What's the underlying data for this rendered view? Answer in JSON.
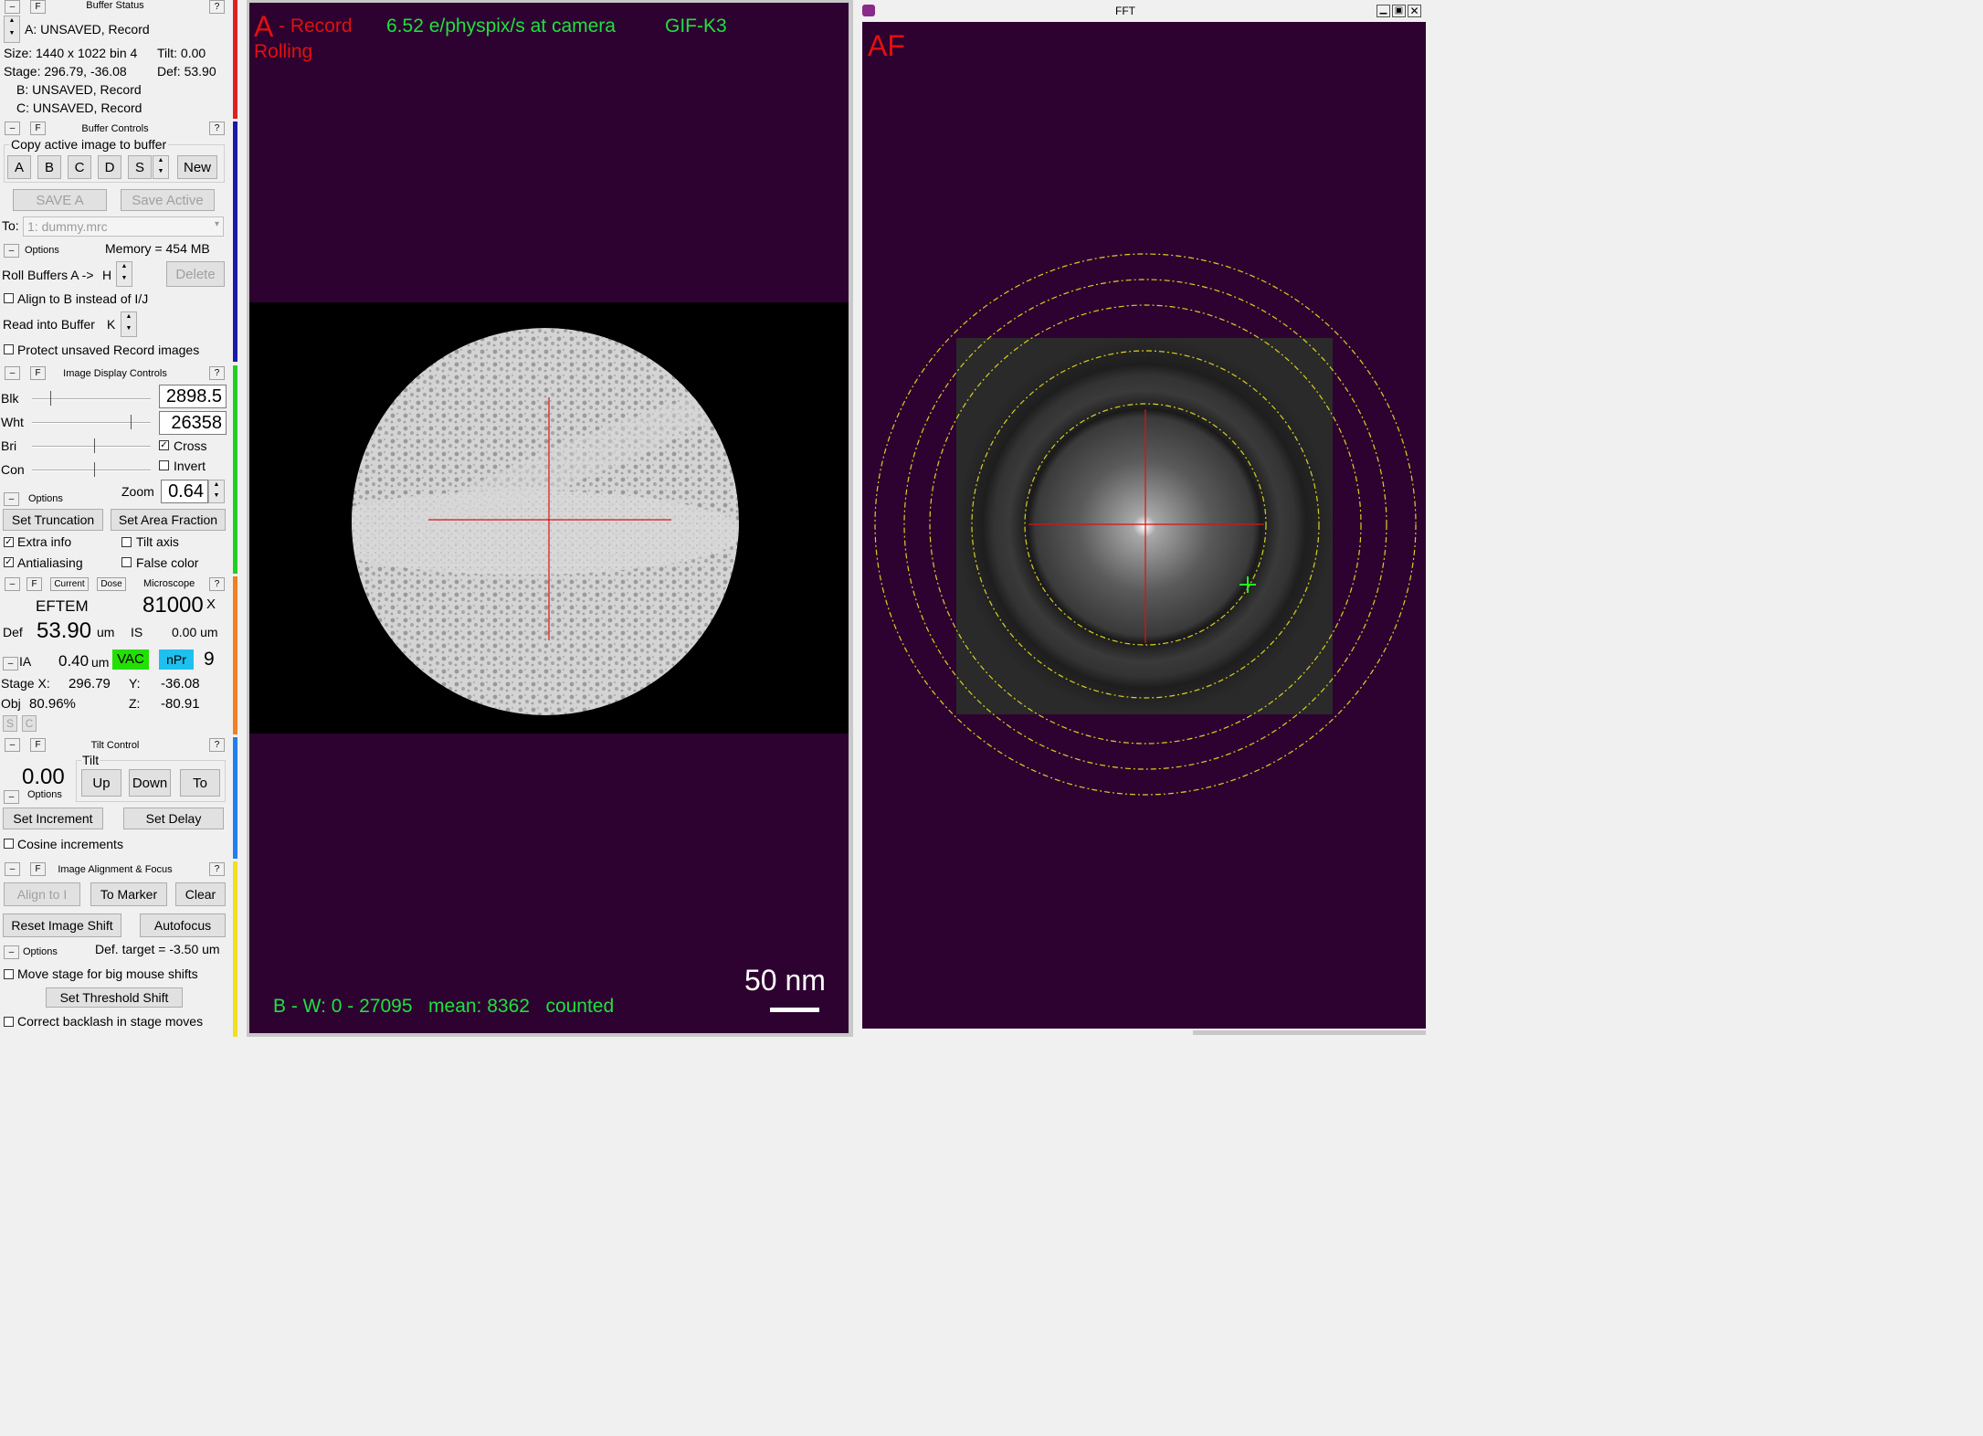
{
  "buffer_status": {
    "title": "Buffer Status",
    "line_a": "A: UNSAVED, Record",
    "line_size": "Size: 1440 x 1022  bin 4",
    "line_tilt": "Tilt: 0.00",
    "line_stage": "Stage: 296.79, -36.08",
    "line_def": "Def: 53.90",
    "line_b": "B: UNSAVED, Record",
    "line_c": "C: UNSAVED, Record"
  },
  "buffer_controls": {
    "title": "Buffer Controls",
    "copy_group": "Copy active image to buffer",
    "buttons": [
      "A",
      "B",
      "C",
      "D",
      "S"
    ],
    "new_label": "New",
    "save_label": "SAVE A",
    "save_active_label": "Save Active",
    "to_label": "To:",
    "to_value": "1: dummy.mrc",
    "options_label": "Options",
    "memory": "Memory = 454 MB",
    "roll_label": "Roll Buffers A ->",
    "roll_value": "H",
    "delete_label": "Delete",
    "align_b_label": "Align to B instead of I/J",
    "read_label": "Read into Buffer",
    "read_value": "K",
    "protect_label": "Protect unsaved Record images"
  },
  "image_display": {
    "title": "Image Display Controls",
    "blk_label": "Blk",
    "blk_value": "2898.5",
    "wht_label": "Wht",
    "wht_value": "26358",
    "bri_label": "Bri",
    "con_label": "Con",
    "cross_label": "Cross",
    "invert_label": "Invert",
    "options_label": "Options",
    "zoom_label": "Zoom",
    "zoom_value": "0.64",
    "set_truncation": "Set Truncation",
    "set_area_fraction": "Set Area Fraction",
    "extra_info": "Extra info",
    "tilt_axis": "Tilt axis",
    "antialiasing": "Antialiasing",
    "false_color": "False color"
  },
  "microscope": {
    "title": "Microscope",
    "current_label": "Current",
    "dose_label": "Dose",
    "mode": "EFTEM",
    "mag": "81000",
    "mag_unit": "X",
    "def_label": "Def",
    "def_value": "53.90",
    "def_unit": "um",
    "is_label": "IS",
    "is_value": "0.00 um",
    "ia_label": "IA",
    "ia_value": "0.40",
    "ia_unit": "um",
    "vac_label": "VAC",
    "npr_label": "nPr",
    "spot": "9",
    "stage_x_label": "Stage X:",
    "stage_x": "296.79",
    "y_label": "Y:",
    "y_value": "-36.08",
    "obj_label": "Obj",
    "obj_value": "80.96%",
    "z_label": "Z:",
    "z_value": "-80.91",
    "s_label": "S",
    "c_label": "C",
    "vac_color": "#22e000",
    "npr_color": "#1ec0f0"
  },
  "tilt_control": {
    "title": "Tilt Control",
    "tilt_group": "Tilt",
    "tilt_value": "0.00",
    "options_label": "Options",
    "up_label": "Up",
    "down_label": "Down",
    "to_label": "To",
    "set_increment": "Set Increment",
    "set_delay": "Set Delay",
    "cosine_label": "Cosine increments"
  },
  "alignment_focus": {
    "title": "Image Alignment & Focus",
    "align_to": "Align to I",
    "to_marker": "To Marker",
    "clear": "Clear",
    "reset_shift": "Reset Image Shift",
    "autofocus": "Autofocus",
    "options_label": "Options",
    "def_target": "Def. target = -3.50 um",
    "move_stage": "Move stage for big mouse shifts",
    "set_threshold": "Set Threshold Shift",
    "backlash": "Correct backlash in stage moves"
  },
  "common": {
    "help": "?",
    "float": "F",
    "minus": "–"
  },
  "image_window": {
    "buffer_letter": "A",
    "record_label": "- Record",
    "rolling_label": "Rolling",
    "dose_rate": "6.52 e/physpix/s at camera",
    "camera": "GIF-K3",
    "scale_bar": "50 nm",
    "stats": "B - W: 0 - 27095   mean: 8362   counted",
    "overlay_red": "#e01010",
    "overlay_green": "#20e040"
  },
  "fft_window": {
    "title": "FFT",
    "af_label": "AF"
  },
  "section_colors": {
    "buffer_status": "#e02020",
    "buffer_controls": "#1a1aa8",
    "image_display": "#20d020",
    "microscope": "#f08020",
    "tilt_control": "#2080f0",
    "alignment_focus": "#f0e020"
  }
}
